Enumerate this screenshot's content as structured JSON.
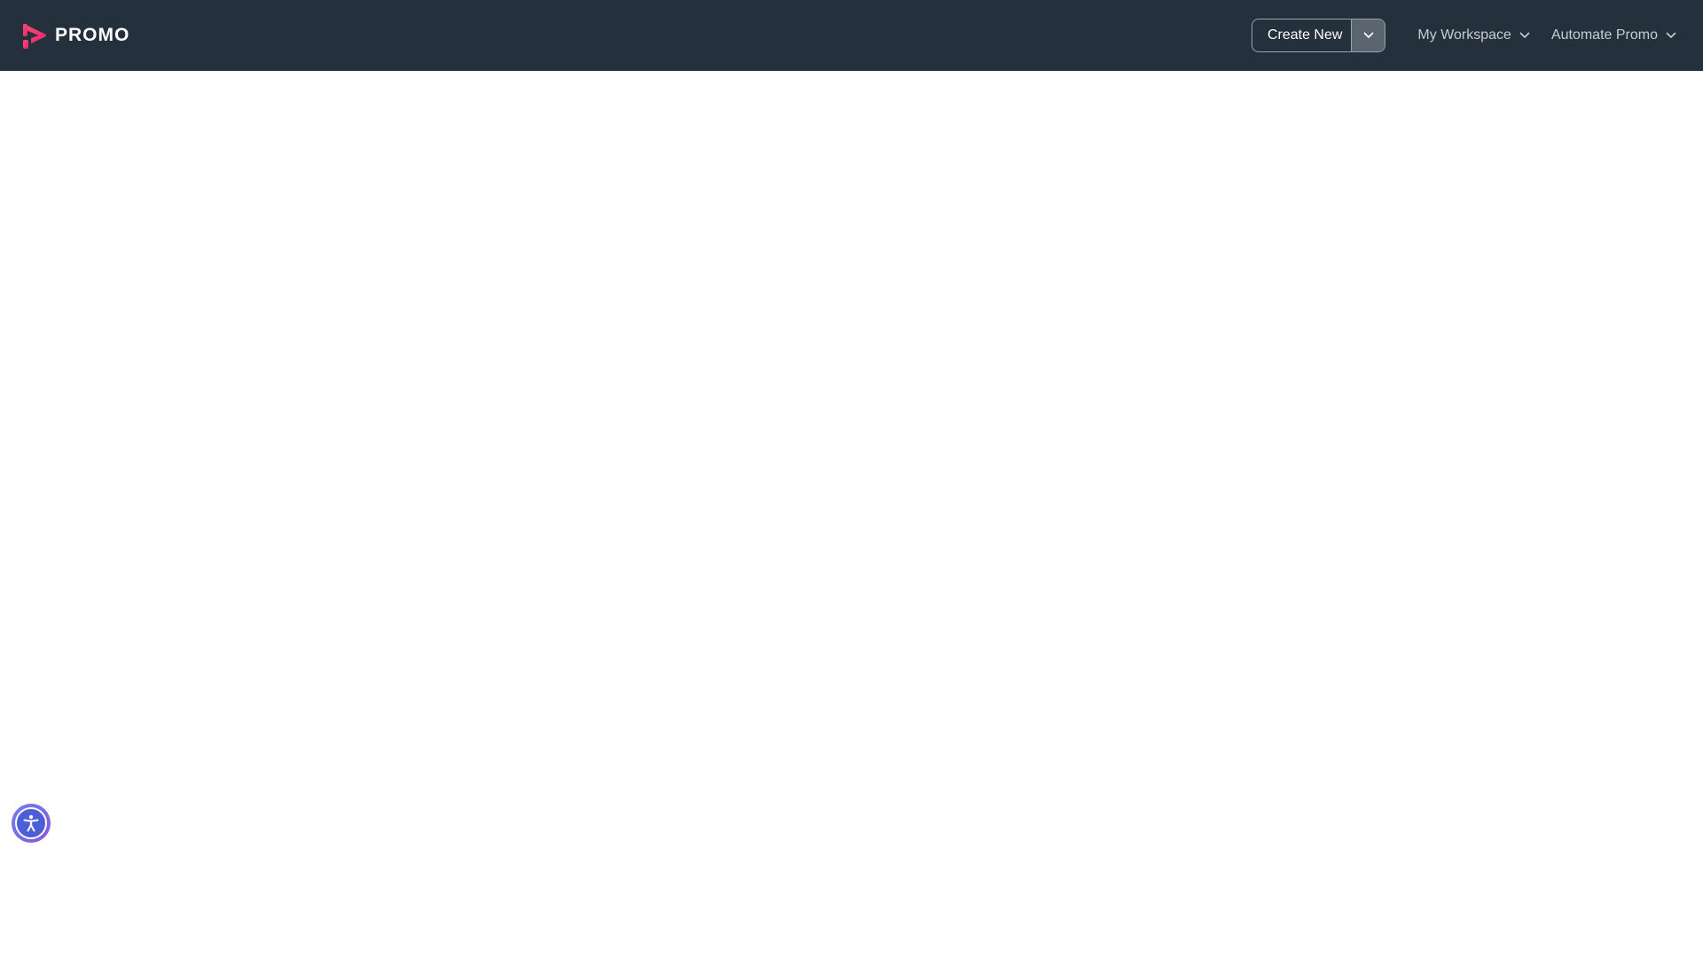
{
  "header": {
    "brand_name": "PROMO",
    "brand_icon": "promo-play-logo",
    "create": {
      "label": "Create New",
      "toggle_icon": "chevron-down-icon"
    },
    "menus": [
      {
        "label": "My Workspace",
        "icon": "chevron-down-icon"
      },
      {
        "label": "Automate Promo",
        "icon": "chevron-down-icon"
      }
    ]
  },
  "accessibility_widget": {
    "icon": "accessibility-person-icon"
  },
  "colors": {
    "header_bg": "#25303d",
    "brand_gradient_start": "#ff3e6c",
    "brand_gradient_end": "#e0266f",
    "accessibility_blue": "#4b60d8",
    "page_bg": "#ffffff"
  }
}
